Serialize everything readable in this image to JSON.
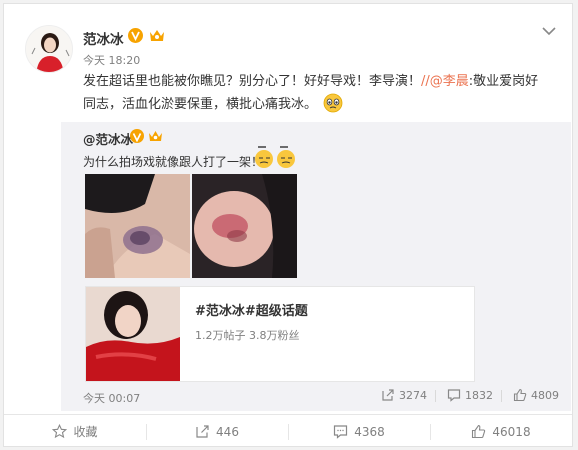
{
  "post": {
    "author": "范冰冰",
    "time": "今天 18:20",
    "text_part1": "发在超话里也能被你瞧见？别分心了！好好导戏！李导演！",
    "mention": "//@李晨",
    "text_part2": ":敬业爱岗好同志，活血化淤要保重，横批心痛我冰。"
  },
  "repost": {
    "author": "@范冰冰",
    "text": "为什么拍场戏就像跟人打了一架！",
    "topic": {
      "title": "#范冰冰#超级话题",
      "stats": "1.2万帖子 3.8万粉丝"
    },
    "time": "今天 00:07",
    "forwards": "3274",
    "comments": "1832",
    "likes": "4809"
  },
  "actions": {
    "favorite": "收藏",
    "forward": "446",
    "comment": "4368",
    "like": "46018"
  },
  "colors": {
    "accent": "#eb7350",
    "vip": "#f7a300"
  }
}
